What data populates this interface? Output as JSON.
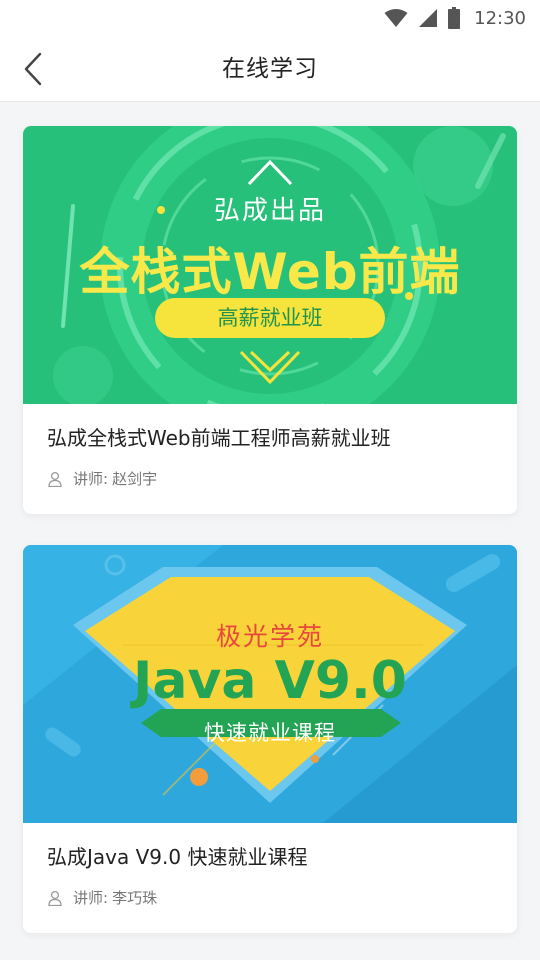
{
  "status_bar": {
    "time": "12:30",
    "icons": [
      "wifi-icon",
      "cell-signal-icon",
      "battery-icon"
    ]
  },
  "nav": {
    "title": "在线学习",
    "back_icon": "chevron-left-icon"
  },
  "courses": [
    {
      "banner": {
        "brand": "弘成出品",
        "headline": "全栈式Web前端",
        "tagline": "高薪就业班",
        "colors": {
          "background": "#27c07a",
          "headline": "#f9e84a",
          "pill": "#f6e33c"
        }
      },
      "title": "弘成全栈式Web前端工程师高薪就业班",
      "teacher_label": "讲师:",
      "teacher_name": "赵剑宇"
    },
    {
      "banner": {
        "brand": "极光学苑",
        "headline": "Java V9.0",
        "tagline": "快速就业课程",
        "colors": {
          "background": "#2ea7dd",
          "headline": "#23a454",
          "diamond": "#f8d43a",
          "brand": "#e8473d"
        }
      },
      "title": "弘成Java V9.0 快速就业课程",
      "teacher_label": "讲师:",
      "teacher_name": "李巧珠"
    }
  ]
}
